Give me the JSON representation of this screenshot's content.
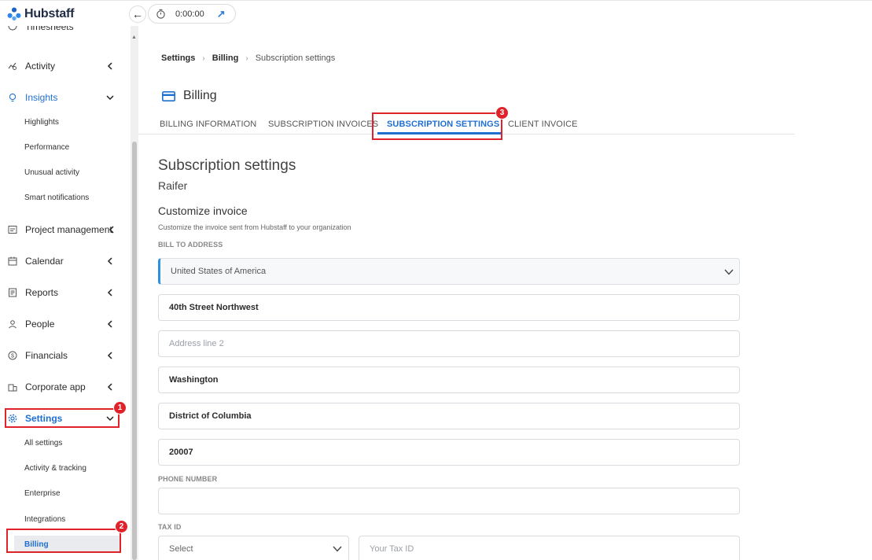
{
  "app": {
    "name": "Hubstaff"
  },
  "timer": {
    "value": "0:00:00"
  },
  "sidebar": {
    "partial_item": "Timesheets",
    "items": [
      {
        "key": "activity",
        "label": "Activity"
      },
      {
        "key": "insights",
        "label": "Insights"
      },
      {
        "key": "project",
        "label": "Project management"
      },
      {
        "key": "calendar",
        "label": "Calendar"
      },
      {
        "key": "reports",
        "label": "Reports"
      },
      {
        "key": "people",
        "label": "People"
      },
      {
        "key": "financials",
        "label": "Financials"
      },
      {
        "key": "corporate",
        "label": "Corporate app"
      },
      {
        "key": "settings",
        "label": "Settings"
      }
    ],
    "insights_sub": [
      "Highlights",
      "Performance",
      "Unusual activity",
      "Smart notifications"
    ],
    "settings_sub": [
      "All settings",
      "Activity & tracking",
      "Enterprise",
      "Integrations",
      "Billing"
    ]
  },
  "annotations": {
    "badge1": "1",
    "badge2": "2",
    "badge3": "3"
  },
  "breadcrumb": [
    "Settings",
    "Billing",
    "Subscription settings"
  ],
  "page": {
    "title": "Billing"
  },
  "tabs": [
    "BILLING INFORMATION",
    "SUBSCRIPTION INVOICES",
    "SUBSCRIPTION SETTINGS",
    "CLIENT INVOICE"
  ],
  "content": {
    "section_title": "Subscription settings",
    "org_name": "Raifer",
    "customize_title": "Customize invoice",
    "customize_help": "Customize the invoice sent from Hubstaff to your organization",
    "bill_to_label": "BILL TO ADDRESS",
    "country": "United States of America",
    "address1": "40th Street Northwest",
    "address2_placeholder": "Address line 2",
    "city": "Washington",
    "state": "District of Columbia",
    "zip": "20007",
    "phone_label": "PHONE NUMBER",
    "phone": "",
    "tax_label": "TAX ID",
    "tax_select_placeholder": "Select",
    "tax_id_placeholder": "Your Tax ID"
  },
  "colors": {
    "accent": "#1f6fd1",
    "highlight": "#e0232b"
  }
}
